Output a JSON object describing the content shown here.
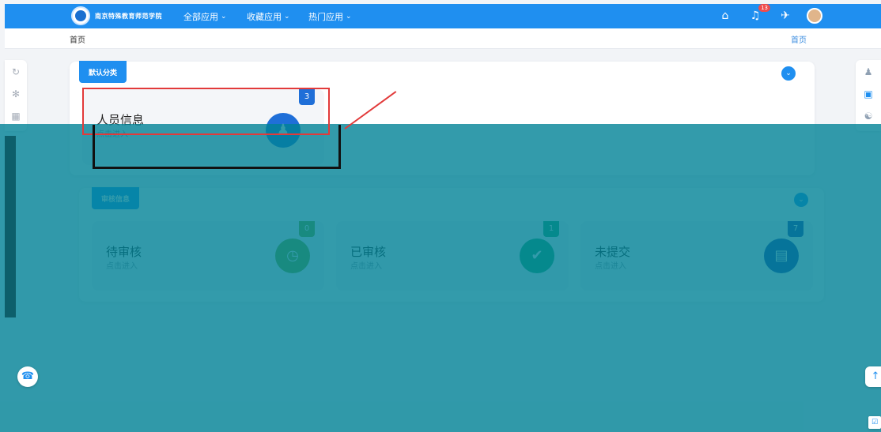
{
  "header": {
    "school_name": "南京特殊教育师范学院",
    "nav": [
      {
        "label": "全部应用"
      },
      {
        "label": "收藏应用"
      },
      {
        "label": "热门应用"
      }
    ],
    "notification_count": "13",
    "icons": [
      "home-icon",
      "bell-icon",
      "plane-icon",
      "avatar"
    ]
  },
  "breadcrumb": {
    "left": "首页",
    "right": "首页"
  },
  "sections": {
    "default": {
      "tag": "默认分类",
      "cards": [
        {
          "title": "人员信息",
          "subtitle": "点击进入",
          "count": "3",
          "color": "#1f6fd8",
          "icon": "people-icon"
        }
      ]
    },
    "review": {
      "tag": "审核信息",
      "cards": [
        {
          "title": "待审核",
          "subtitle": "点击进入",
          "count": "0",
          "color": "#7aa82a",
          "icon": "clock-icon"
        },
        {
          "title": "已审核",
          "subtitle": "点击进入",
          "count": "1",
          "color": "#1aa36b",
          "icon": "check-icon"
        },
        {
          "title": "未提交",
          "subtitle": "点击进入",
          "count": "7",
          "color": "#1e3ea8",
          "icon": "doc-icon"
        }
      ]
    }
  },
  "colors": {
    "primary": "#1f8ff0",
    "overlay": "#00838f"
  }
}
